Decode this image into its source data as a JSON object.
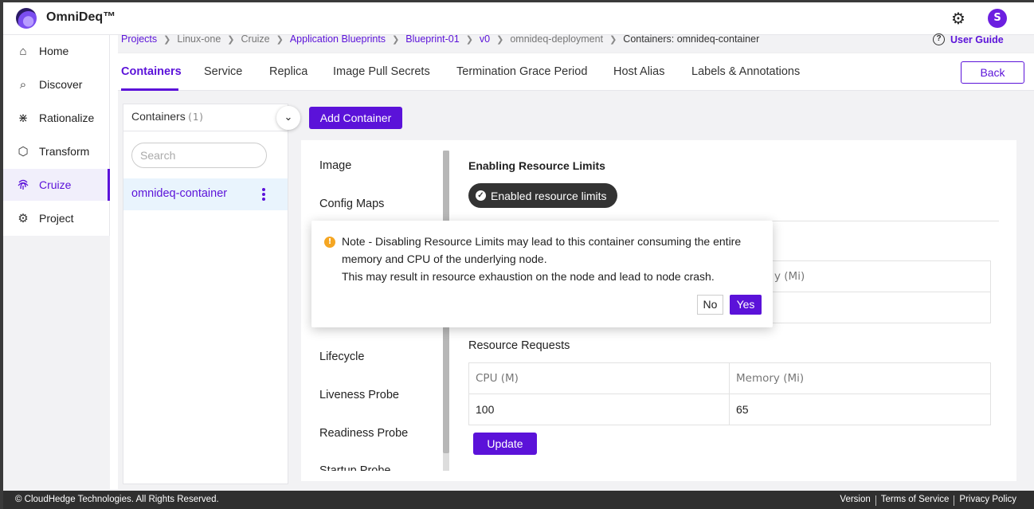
{
  "app": {
    "brand": "OmniDeq™",
    "avatar_letter": "S"
  },
  "sidebar": {
    "items": [
      {
        "label": "Home",
        "icon": "home-icon"
      },
      {
        "label": "Discover",
        "icon": "discover-icon"
      },
      {
        "label": "Rationalize",
        "icon": "rationalize-icon"
      },
      {
        "label": "Transform",
        "icon": "cube-icon"
      },
      {
        "label": "Cruize",
        "icon": "fingerprint-icon",
        "active": true
      },
      {
        "label": "Project",
        "icon": "gear-icon"
      }
    ]
  },
  "breadcrumb": {
    "items": [
      "Projects",
      "Linux-one",
      "Cruize",
      "Application Blueprints",
      "Blueprint-01",
      "v0",
      "omnideq-deployment",
      "Containers: omnideq-container"
    ]
  },
  "user_guide": "User Guide",
  "tabs": [
    "Containers",
    "Service",
    "Replica",
    "Image Pull Secrets",
    "Termination Grace Period",
    "Host Alias",
    "Labels & Annotations"
  ],
  "back_label": "Back",
  "containers": {
    "title": "Containers",
    "count": "(1)",
    "search_placeholder": "Search",
    "items": [
      "omnideq-container"
    ]
  },
  "add_container_label": "Add Container",
  "config_menu": [
    "Image",
    "Config Maps",
    "Lifecycle",
    "Liveness Probe",
    "Readiness Probe",
    "Startup Probe"
  ],
  "resource_limits": {
    "title": "Enabling Resource Limits",
    "pill_label": "Enabled resource limits",
    "limits_memory_header_partial": "y (Mi)"
  },
  "resource_requests": {
    "title": "Resource Requests",
    "headers": [
      "CPU (M)",
      "Memory (Mi)"
    ],
    "values": [
      "100",
      "65"
    ]
  },
  "update_label": "Update",
  "popover": {
    "line1": "Note - Disabling Resource Limits may lead to this container consuming the entire memory and CPU of the underlying node.",
    "line2": "This may result in resource exhaustion on the node and lead to node crash.",
    "no_label": "No",
    "yes_label": "Yes"
  },
  "footer": {
    "copyright": "© CloudHedge Technologies. All Rights Reserved.",
    "links": [
      "Version",
      "Terms of Service",
      "Privacy Policy"
    ]
  },
  "colors": {
    "accent": "#5b12d9",
    "pill": "#333333",
    "warning": "#f5a623",
    "footer": "#2f2f2f"
  }
}
